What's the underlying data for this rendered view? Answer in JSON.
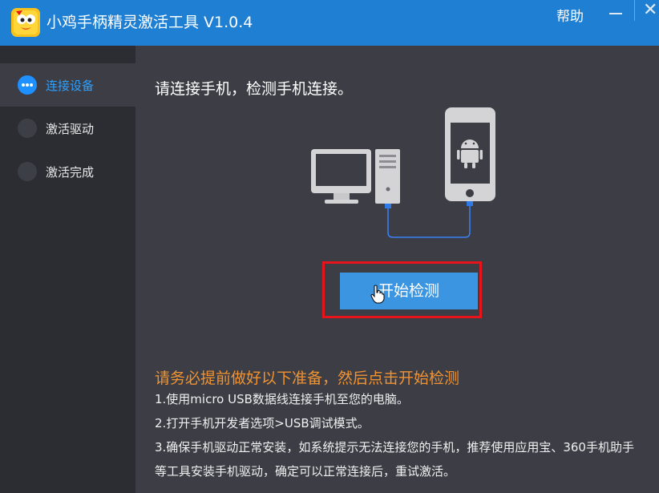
{
  "window": {
    "title": "小鸡手柄精灵激活工具 V1.0.4",
    "help_label": "帮助",
    "close_glyph": "✕"
  },
  "sidebar": {
    "steps": [
      {
        "label": "连接设备",
        "active": true
      },
      {
        "label": "激活驱动",
        "active": false
      },
      {
        "label": "激活完成",
        "active": false
      }
    ]
  },
  "main": {
    "title": "请连接手机，检测手机连接。",
    "start_button": "开始检测",
    "notice_title": "请务必提前做好以下准备，然后点击开始检测",
    "notes": [
      "1.使用micro USB数据线连接手机至您的电脑。",
      "2.打开手机开发者选项>USB调试模式。",
      "3.确保手机驱动正常安装，如系统提示无法连接您的手机，推荐使用应用宝、360手机助手",
      "  等工具安装手机驱动，确定可以正常连接后，重试激活。"
    ]
  },
  "colors": {
    "titlebar": "#1f7fd3",
    "sidebar": "#2c2d33",
    "content": "#3c3d45",
    "active_step": "#2ea0ff",
    "button": "#3b95e0",
    "highlight": "#e8141c",
    "notice": "#f09332",
    "cable": "#3b82f6"
  },
  "icons": [
    "app-logo-icon",
    "minimize-icon",
    "close-icon",
    "computer-icon",
    "android-phone-icon",
    "usb-cable-icon",
    "hand-cursor-icon"
  ]
}
